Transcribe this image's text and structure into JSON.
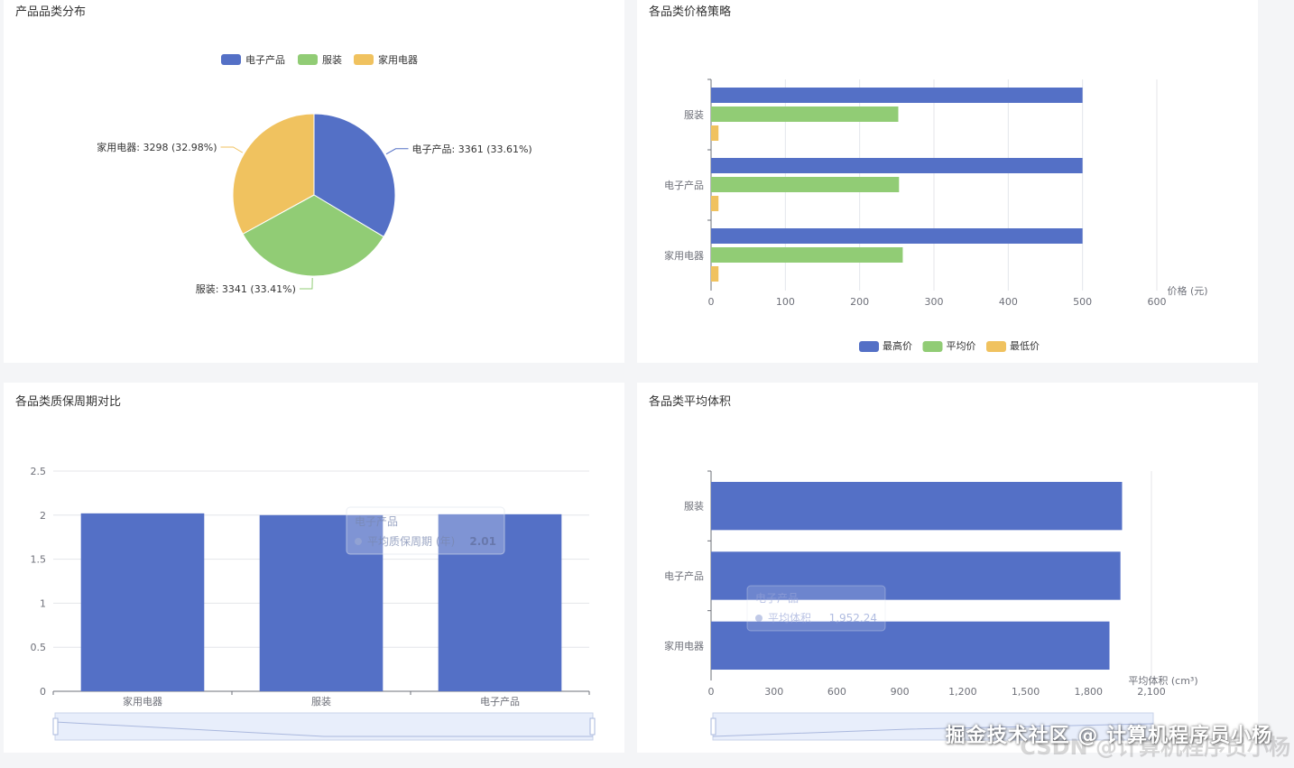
{
  "colors": {
    "blue": "#5470c6",
    "green": "#91cc75",
    "yellow": "#f0c25f",
    "axis": "#6e7079",
    "grid": "#e4e6ea"
  },
  "panels": {
    "pie": {
      "title": "产品品类分布"
    },
    "price": {
      "title": "各品类价格策略"
    },
    "warranty": {
      "title": "各品类质保周期对比"
    },
    "volume": {
      "title": "各品类平均体积"
    }
  },
  "chart_data": [
    {
      "type": "pie",
      "title": "产品品类分布",
      "legend": [
        "电子产品",
        "服装",
        "家用电器"
      ],
      "legend_position": "top",
      "slices": [
        {
          "name": "电子产品",
          "value": 3361,
          "percent": 33.61,
          "label": "电子产品: 3361 (33.61%)"
        },
        {
          "name": "服装",
          "value": 3341,
          "percent": 33.41,
          "label": "服装: 3341 (33.41%)"
        },
        {
          "name": "家用电器",
          "value": 3298,
          "percent": 32.98,
          "label": "家用电器: 3298 (32.98%)"
        }
      ]
    },
    {
      "type": "bar",
      "orientation": "horizontal",
      "title": "各品类价格策略",
      "categories": [
        "服装",
        "电子产品",
        "家用电器"
      ],
      "series": [
        {
          "name": "最高价",
          "values": [
            500,
            500,
            500
          ]
        },
        {
          "name": "平均价",
          "values": [
            252,
            253,
            258
          ]
        },
        {
          "name": "最低价",
          "values": [
            10,
            10,
            10
          ]
        }
      ],
      "xlabel": "价格 (元)",
      "xlim": [
        0,
        600
      ],
      "xticks": [
        "0",
        "100",
        "200",
        "300",
        "400",
        "500",
        "600"
      ],
      "legend_position": "bottom",
      "grid": true
    },
    {
      "type": "bar",
      "orientation": "vertical",
      "title": "各品类质保周期对比",
      "categories": [
        "家用电器",
        "服装",
        "电子产品"
      ],
      "series": [
        {
          "name": "平均质保周期 (年)",
          "values": [
            2.02,
            2.0,
            2.01
          ]
        }
      ],
      "ylim": [
        0,
        2.5
      ],
      "yticks": [
        "0",
        "0.5",
        "1",
        "1.5",
        "2",
        "2.5"
      ],
      "grid": true,
      "tooltip": {
        "category": "电子产品",
        "series": "平均质保周期 (年)",
        "value": "2.01"
      }
    },
    {
      "type": "bar",
      "orientation": "horizontal",
      "title": "各品类平均体积",
      "categories": [
        "服装",
        "电子产品",
        "家用电器"
      ],
      "series": [
        {
          "name": "平均体积",
          "values": [
            1960,
            1952.24,
            1900
          ]
        }
      ],
      "xlabel": "平均体积 (cm³)",
      "xlim": [
        0,
        2100
      ],
      "xticks": [
        "0",
        "300",
        "600",
        "900",
        "1,200",
        "1,500",
        "1,800",
        "2,100"
      ],
      "grid": true,
      "tooltip": {
        "category": "电子产品",
        "series": "平均体积",
        "value": "1,952.24"
      }
    }
  ],
  "watermark": {
    "text": "掘金技术社区 @ 计算机程序员小杨",
    "shadow": "CSDN @计算机程序员小杨"
  }
}
